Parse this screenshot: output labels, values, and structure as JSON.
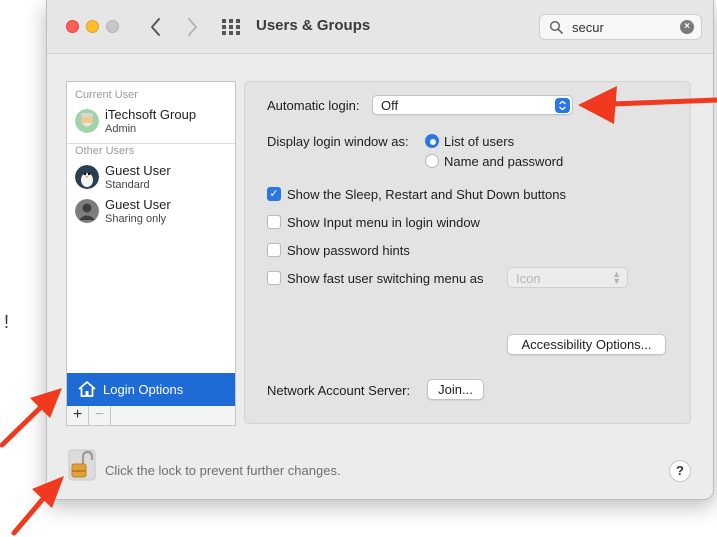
{
  "window": {
    "title": "Users & Groups"
  },
  "search": {
    "value": "secur",
    "placeholder": "Search"
  },
  "sidebar": {
    "current_user_label": "Current User",
    "other_users_label": "Other Users",
    "users": [
      {
        "name": "iTechsoft Group",
        "role": "Admin"
      },
      {
        "name": "Guest User",
        "role": "Standard"
      },
      {
        "name": "Guest User",
        "role": "Sharing only"
      }
    ],
    "login_options_label": "Login Options",
    "add_label": "+",
    "remove_label": "−"
  },
  "settings": {
    "automatic_login_label": "Automatic login:",
    "automatic_login_value": "Off",
    "display_login_label": "Display login window as:",
    "radio_list_label": "List of users",
    "radio_name_label": "Name and password",
    "check_sleep_label": "Show the Sleep, Restart and Shut Down buttons",
    "check_input_label": "Show Input menu in login window",
    "check_hints_label": "Show password hints",
    "check_fast_label": "Show fast user switching menu as",
    "fast_menu_value": "Icon",
    "accessibility_button": "Accessibility Options...",
    "network_label": "Network Account Server:",
    "join_button": "Join..."
  },
  "footer": {
    "lock_text": "Click the lock to prevent further changes.",
    "help_label": "?"
  },
  "colors": {
    "accent": "#2b76e5",
    "selection": "#1f6bd6",
    "annotation_arrow": "#f0391e"
  }
}
